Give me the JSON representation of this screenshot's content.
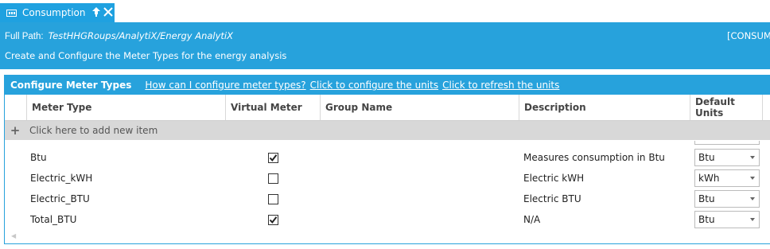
{
  "tab": {
    "label": "Consumption"
  },
  "header": {
    "path_label": "Full Path:",
    "path_value": "TestHHGRoups/AnalytiX/Energy AnalytiX",
    "path_right": "[CONSUM",
    "description": "Create and Configure the Meter Types for the energy analysis"
  },
  "panel": {
    "title": "Configure Meter Types",
    "links": [
      "How can I configure meter types?",
      "Click to configure the units",
      "Click to refresh the units"
    ]
  },
  "grid": {
    "columns": [
      "Meter Type",
      "Virtual Meter",
      "Group Name",
      "Description",
      "Default Units"
    ],
    "add_row_label": "Click here to add new item",
    "rows": [
      {
        "meter_type": "Btu",
        "virtual": true,
        "group": "",
        "description": "Measures consumption in Btu",
        "units": "Btu"
      },
      {
        "meter_type": "Electric_kWH",
        "virtual": false,
        "group": "",
        "description": "Electric kWH",
        "units": "kWh"
      },
      {
        "meter_type": "Electric_BTU",
        "virtual": false,
        "group": "",
        "description": "Electric BTU",
        "units": "Btu"
      },
      {
        "meter_type": "Total_BTU",
        "virtual": true,
        "group": "",
        "description": "N/A",
        "units": "Btu"
      }
    ]
  },
  "icons": {
    "tab": "window-icon",
    "pin": "pin-icon",
    "close": "close-icon",
    "check": "checkmark-icon",
    "dropdown": "chevron-down-icon"
  },
  "colors": {
    "accent": "#27a2dc",
    "add_row_bg": "#d8d8d8"
  }
}
